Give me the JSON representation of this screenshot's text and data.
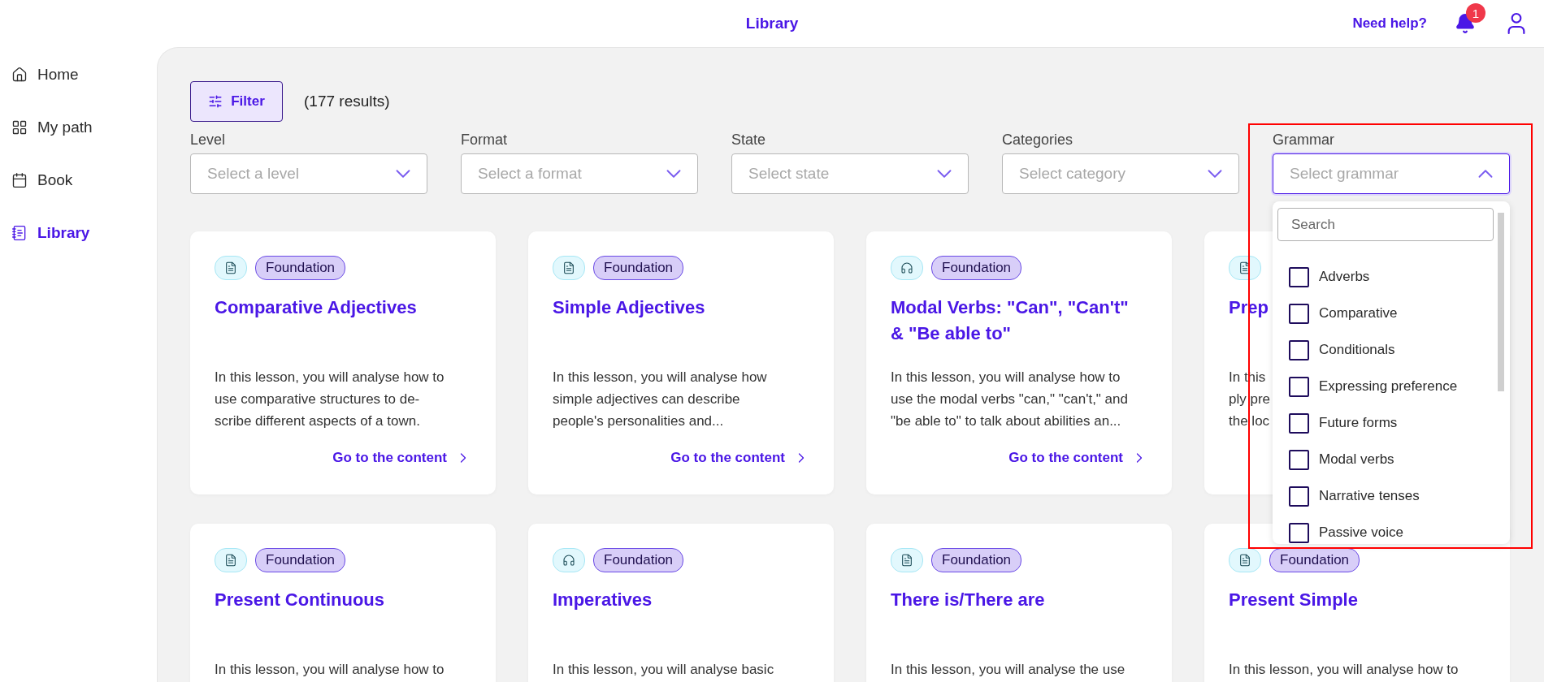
{
  "header": {
    "title": "Library",
    "help_link": "Need help?",
    "notification_count": "1"
  },
  "sidebar": {
    "items": [
      {
        "label": "Home",
        "selected": false
      },
      {
        "label": "My path",
        "selected": false
      },
      {
        "label": "Book",
        "selected": false
      },
      {
        "label": "Library",
        "selected": true
      }
    ]
  },
  "toolbar": {
    "filter_button": "Filter",
    "result_count": "(177 results)"
  },
  "filters": [
    {
      "label": "Level",
      "placeholder": "Select a level",
      "expanded": false
    },
    {
      "label": "Format",
      "placeholder": "Select a format",
      "expanded": false
    },
    {
      "label": "State",
      "placeholder": "Select state",
      "expanded": false
    },
    {
      "label": "Categories",
      "placeholder": "Select category",
      "expanded": false
    },
    {
      "label": "Grammar",
      "placeholder": "Select grammar",
      "expanded": true
    }
  ],
  "grammar_dropdown": {
    "search_placeholder": "Search",
    "options": [
      {
        "label": "Adverbs",
        "checked": false
      },
      {
        "label": "Comparative",
        "checked": false
      },
      {
        "label": "Conditionals",
        "checked": false
      },
      {
        "label": "Expressing preference",
        "checked": false
      },
      {
        "label": "Future forms",
        "checked": false
      },
      {
        "label": "Modal verbs",
        "checked": false
      },
      {
        "label": "Narrative tenses",
        "checked": false
      },
      {
        "label": "Passive voice",
        "checked": false
      }
    ]
  },
  "cards": [
    {
      "kind": "document",
      "level": "Foundation",
      "title": "Comparative Adjectives",
      "description": "In this lesson, you will analyse how to\nuse comparative structures to de-\nscribe different aspects of a town.",
      "link": "Go to the content"
    },
    {
      "kind": "document",
      "level": "Foundation",
      "title": "Simple Adjectives",
      "description": "In this lesson, you will analyse how\nsimple adjectives can describe\npeople's personalities and...",
      "link": "Go to the content"
    },
    {
      "kind": "audio",
      "level": "Foundation",
      "title": "Modal Verbs: \"Can\", \"Can't\" & \"Be able to\"",
      "description": "In this lesson, you will analyse how to\nuse the modal verbs \"can,\" \"can't,\" and\n\"be able to\" to talk about abilities an...",
      "link": "Go to the content"
    },
    {
      "kind": "document",
      "title": "Prep",
      "description": "In this\nply pre\nthe loc"
    },
    {
      "kind": "document",
      "level": "Foundation",
      "title": "Present Continuous",
      "description": "In this lesson, you will analyse how to"
    },
    {
      "kind": "audio",
      "level": "Foundation",
      "title": "Imperatives",
      "description": "In this lesson, you will analyse basic"
    },
    {
      "kind": "document",
      "level": "Foundation",
      "title": "There is/There are",
      "description": "In this lesson, you will analyse the use"
    },
    {
      "kind": "document",
      "level": "Foundation",
      "title": "Present Simple",
      "description": "In this lesson, you will analyse how to"
    }
  ]
}
